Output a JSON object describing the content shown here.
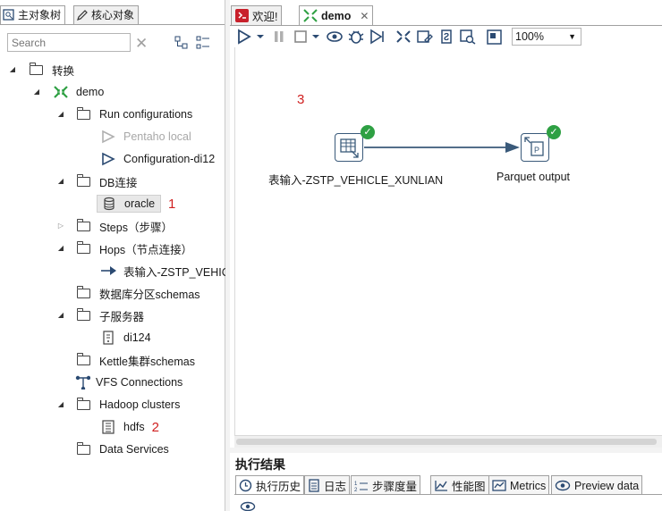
{
  "left_tabs": [
    {
      "label": "主对象树"
    },
    {
      "label": "核心对象"
    }
  ],
  "search": {
    "placeholder": "Search"
  },
  "tree": {
    "root": "转换",
    "transform": "demo",
    "run_configurations": {
      "label": "Run configurations",
      "items": [
        "Pentaho local",
        "Configuration-di12"
      ]
    },
    "db_connections": {
      "label": "DB连接",
      "items": [
        "oracle"
      ],
      "annotation": "1"
    },
    "steps": "Steps（步骤）",
    "hops": {
      "label": "Hops（节点连接）",
      "items": [
        "表输入-ZSTP_VEHIC"
      ]
    },
    "partition_schemas": "数据库分区schemas",
    "slave_servers": {
      "label": "子服务器",
      "items": [
        "di124"
      ]
    },
    "cluster_schemas": "Kettle集群schemas",
    "vfs": "VFS Connections",
    "hadoop": {
      "label": "Hadoop clusters",
      "items": [
        "hdfs"
      ],
      "annotation": "2"
    },
    "data_services": "Data Services"
  },
  "editor_tabs": [
    {
      "label": "欢迎!"
    },
    {
      "label": "demo"
    }
  ],
  "toolbar": {
    "zoom": "100%"
  },
  "canvas": {
    "annotation": "3",
    "steps": [
      {
        "label": "表输入-ZSTP_VEHICLE_XUNLIAN",
        "status": "ok"
      },
      {
        "label": "Parquet output",
        "status": "ok"
      }
    ]
  },
  "results": {
    "title": "执行结果",
    "tabs": [
      "执行历史",
      "日志",
      "步骤度量",
      "性能图",
      "Metrics",
      "Preview data"
    ]
  },
  "colors": {
    "accent": "#2b4a72",
    "ok": "#2ea043",
    "annotation": "#d02020"
  }
}
